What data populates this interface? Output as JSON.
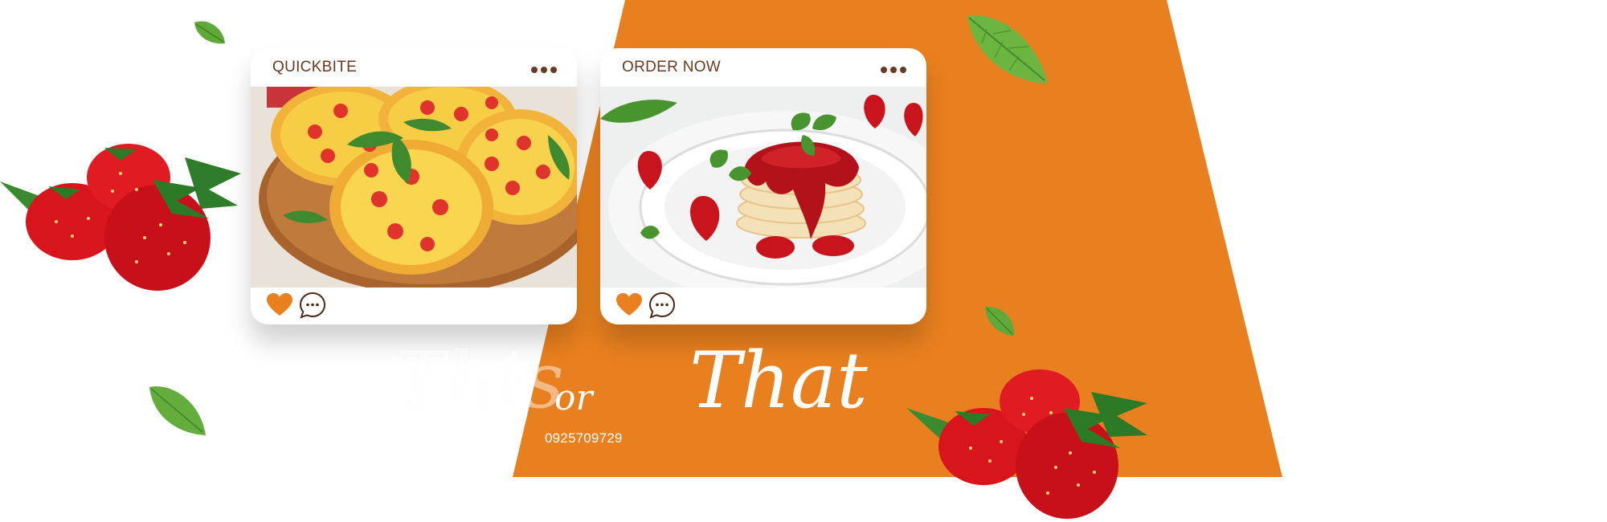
{
  "colors": {
    "brand_orange": "#e9801f",
    "text_brown": "#6b3a1f",
    "white": "#ffffff"
  },
  "cards": [
    {
      "title": "QUICKBITE",
      "photo": "mini-pizzas-photo",
      "actions": [
        "heart-icon",
        "comment-icon"
      ],
      "menu_icon": "more-dots-icon"
    },
    {
      "title": "ORDER NOW",
      "photo": "strawberry-pancakes-photo",
      "actions": [
        "heart-icon",
        "comment-icon"
      ],
      "menu_icon": "more-dots-icon"
    }
  ],
  "headline": {
    "word1": "This",
    "word2": "or",
    "word3": "That"
  },
  "contact": {
    "phone": "0925709729"
  }
}
